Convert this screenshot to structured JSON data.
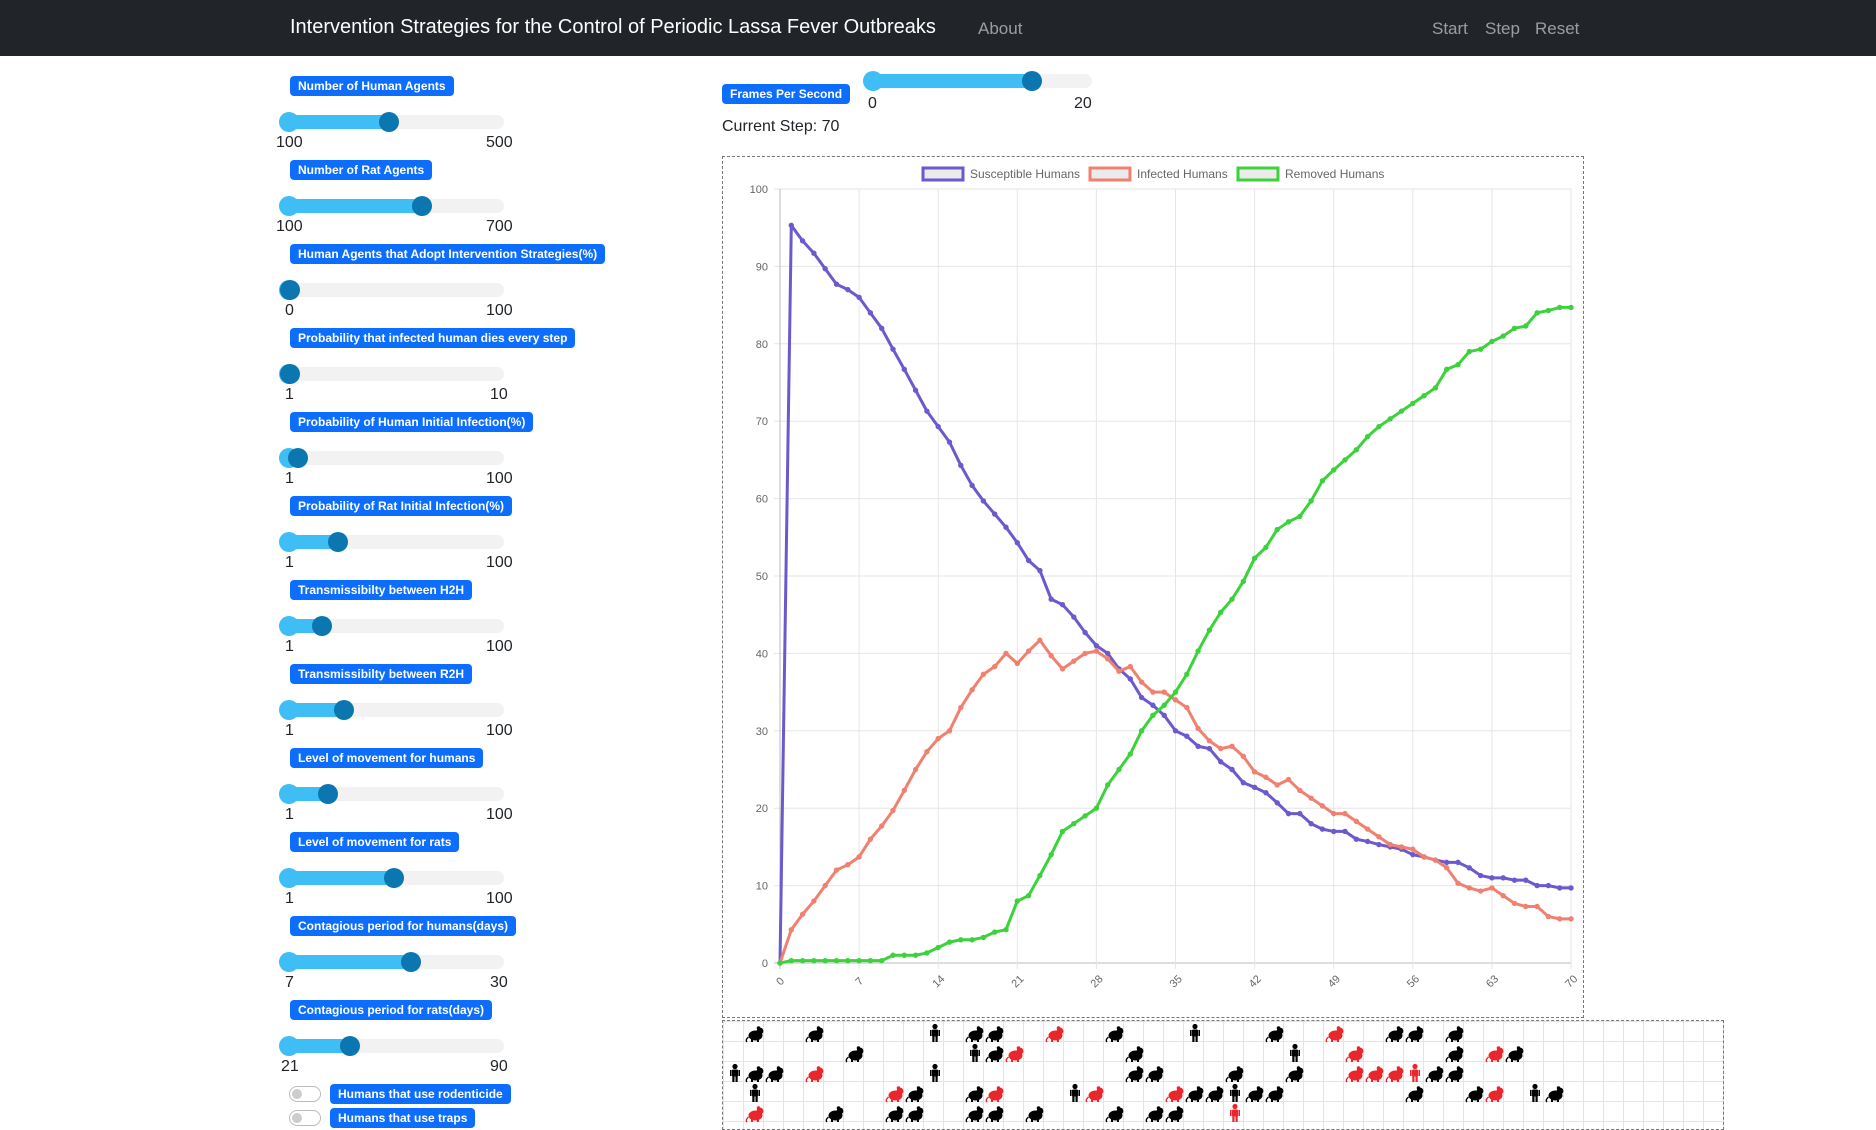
{
  "navbar": {
    "title": "Intervention Strategies for the Control of Periodic Lassa Fever Outbreaks",
    "about": "About",
    "start": "Start",
    "step": "Step",
    "reset": "Reset"
  },
  "fps": {
    "label": "Frames Per Second",
    "min": "0",
    "max": "20",
    "value": 16
  },
  "current_step": "Current Step: 70",
  "controls": [
    {
      "label": "Number of Human Agents",
      "min": "100",
      "max": "500",
      "value": 300
    },
    {
      "label": "Number of Rat Agents",
      "min": "100",
      "max": "700",
      "value": 500
    },
    {
      "label": "Human Agents that Adopt Intervention Strategies(%)",
      "min": "0",
      "max": "100",
      "value": 0
    },
    {
      "label": "Probability that infected human dies every step",
      "min": "1",
      "max": "10",
      "value": 1
    },
    {
      "label": "Probability of Human Initial Infection(%)",
      "min": "1",
      "max": "100",
      "value": 5
    },
    {
      "label": "Probability of Rat Initial Infection(%)",
      "min": "1",
      "max": "100",
      "value": 25
    },
    {
      "label": "Transmissibilty between H2H",
      "min": "1",
      "max": "100",
      "value": 17
    },
    {
      "label": "Transmissibilty between R2H",
      "min": "1",
      "max": "100",
      "value": 28
    },
    {
      "label": "Level of movement for humans",
      "min": "1",
      "max": "100",
      "value": 20
    },
    {
      "label": "Level of movement for rats",
      "min": "1",
      "max": "100",
      "value": 53
    },
    {
      "label": "Contagious period for humans(days)",
      "min": "7",
      "max": "30",
      "value": 21
    },
    {
      "label": "Contagious period for rats(days)",
      "min": "21",
      "max": "90",
      "value": 42
    }
  ],
  "toggles": [
    {
      "label": "Humans that use rodenticide",
      "on": false
    },
    {
      "label": "Humans that use traps",
      "on": false
    }
  ],
  "chart_data": {
    "type": "line",
    "legend_position": "top",
    "grid": true,
    "ylim": [
      0,
      100
    ],
    "xlim": [
      0,
      70
    ],
    "y_ticks": [
      "0",
      "10",
      "20",
      "30",
      "40",
      "50",
      "60",
      "70",
      "80",
      "90",
      "100"
    ],
    "x_ticks": [
      "0",
      "7",
      "14",
      "21",
      "28",
      "35",
      "42",
      "49",
      "56",
      "63",
      "70"
    ],
    "series": [
      {
        "name": "Susceptible Humans",
        "color": "#6a5acd",
        "values": [
          0,
          95.3,
          93.3,
          91.7,
          89.7,
          87.7,
          87,
          86,
          84,
          82,
          79.3,
          76.7,
          74,
          71.3,
          69.3,
          67.3,
          64.3,
          61.7,
          59.7,
          58,
          56.3,
          54.3,
          52,
          50.7,
          47,
          46.3,
          44.7,
          42.7,
          41,
          40,
          38,
          36.7,
          34.3,
          33.3,
          32,
          30,
          29.3,
          28,
          27.7,
          26,
          25,
          23.3,
          22.7,
          22,
          20.7,
          19.3,
          19.3,
          18,
          17.3,
          17,
          17,
          16,
          15.7,
          15.3,
          15,
          14.7,
          14,
          13.7,
          13.3,
          13,
          13,
          12.3,
          11.3,
          11,
          11,
          10.7,
          10.7,
          10,
          10,
          9.7,
          9.7
        ]
      },
      {
        "name": "Infected Humans",
        "color": "#f08070",
        "values": [
          0,
          4.3,
          6.3,
          8,
          10,
          12,
          12.7,
          13.7,
          16,
          17.7,
          19.7,
          22.3,
          25,
          27.3,
          29,
          30,
          33,
          35.3,
          37.3,
          38.3,
          40,
          38.7,
          40.3,
          41.7,
          39.7,
          38,
          39,
          40,
          40.3,
          39.3,
          37.7,
          38.3,
          36.3,
          35,
          35,
          34,
          33,
          30.3,
          28.7,
          27.7,
          28,
          26.7,
          24.7,
          24,
          23,
          23.7,
          22.3,
          21.3,
          20.3,
          19.3,
          19.3,
          18.3,
          17.3,
          16.3,
          15.3,
          15,
          14.7,
          13.7,
          13.3,
          12.3,
          10.3,
          9.7,
          9.3,
          9.7,
          8.7,
          7.7,
          7.3,
          7.3,
          6,
          5.7,
          5.7
        ]
      },
      {
        "name": "Removed Humans",
        "color": "#3cd23c",
        "values": [
          0,
          0.3,
          0.3,
          0.3,
          0.3,
          0.3,
          0.3,
          0.3,
          0.3,
          0.3,
          1,
          1,
          1,
          1.3,
          2,
          2.7,
          3,
          3,
          3.3,
          4,
          4.3,
          8,
          8.7,
          11.3,
          14,
          17,
          18,
          19,
          20,
          23,
          25,
          27,
          30,
          32,
          33.3,
          35,
          37.3,
          40.3,
          43,
          45.3,
          47,
          49.3,
          52.3,
          53.7,
          56,
          57,
          57.7,
          59.7,
          62.3,
          63.7,
          65,
          66.3,
          68,
          69.3,
          70.3,
          71.3,
          72.3,
          73.3,
          74.3,
          76.7,
          77.3,
          79,
          79.3,
          80.3,
          81,
          82,
          82.3,
          84,
          84.3,
          84.7,
          84.7
        ]
      }
    ]
  },
  "agents": [
    [
      "rat",
      "black",
      1,
      0
    ],
    [
      "rat",
      "black",
      4,
      0
    ],
    [
      "human",
      "black",
      10,
      0
    ],
    [
      "rat",
      "black",
      12,
      0
    ],
    [
      "rat",
      "black",
      13,
      0
    ],
    [
      "rat",
      "red",
      16,
      0
    ],
    [
      "rat",
      "black",
      19,
      0
    ],
    [
      "human",
      "black",
      23,
      0
    ],
    [
      "rat",
      "black",
      27,
      0
    ],
    [
      "rat",
      "red",
      30,
      0
    ],
    [
      "rat",
      "black",
      33,
      0
    ],
    [
      "rat",
      "black",
      34,
      0
    ],
    [
      "rat",
      "black",
      36,
      0
    ],
    [
      "rat",
      "black",
      6,
      1
    ],
    [
      "human",
      "black",
      12,
      1
    ],
    [
      "rat",
      "black",
      13,
      1
    ],
    [
      "rat",
      "red",
      14,
      1
    ],
    [
      "rat",
      "black",
      20,
      1
    ],
    [
      "human",
      "black",
      28,
      1
    ],
    [
      "rat",
      "red",
      31,
      1
    ],
    [
      "rat",
      "black",
      36,
      1
    ],
    [
      "rat",
      "red",
      38,
      1
    ],
    [
      "rat",
      "black",
      39,
      1
    ],
    [
      "human",
      "black",
      0,
      2
    ],
    [
      "rat",
      "black",
      1,
      2
    ],
    [
      "rat",
      "black",
      2,
      2
    ],
    [
      "rat",
      "red",
      4,
      2
    ],
    [
      "human",
      "black",
      10,
      2
    ],
    [
      "rat",
      "black",
      20,
      2
    ],
    [
      "rat",
      "black",
      21,
      2
    ],
    [
      "rat",
      "black",
      25,
      2
    ],
    [
      "rat",
      "black",
      28,
      2
    ],
    [
      "rat",
      "red",
      31,
      2
    ],
    [
      "rat",
      "red",
      32,
      2
    ],
    [
      "rat",
      "red",
      33,
      2
    ],
    [
      "human",
      "red",
      34,
      2
    ],
    [
      "rat",
      "black",
      35,
      2
    ],
    [
      "rat",
      "black",
      36,
      2
    ],
    [
      "human",
      "black",
      1,
      3
    ],
    [
      "rat",
      "red",
      8,
      3
    ],
    [
      "rat",
      "black",
      9,
      3
    ],
    [
      "rat",
      "black",
      12,
      3
    ],
    [
      "rat",
      "red",
      13,
      3
    ],
    [
      "human",
      "black",
      17,
      3
    ],
    [
      "rat",
      "red",
      18,
      3
    ],
    [
      "rat",
      "red",
      22,
      3
    ],
    [
      "rat",
      "black",
      23,
      3
    ],
    [
      "rat",
      "black",
      24,
      3
    ],
    [
      "human",
      "black",
      25,
      3
    ],
    [
      "rat",
      "black",
      26,
      3
    ],
    [
      "rat",
      "black",
      27,
      3
    ],
    [
      "rat",
      "black",
      34,
      3
    ],
    [
      "rat",
      "black",
      37,
      3
    ],
    [
      "rat",
      "red",
      38,
      3
    ],
    [
      "human",
      "black",
      40,
      3
    ],
    [
      "rat",
      "black",
      41,
      3
    ],
    [
      "rat",
      "red",
      1,
      4
    ],
    [
      "rat",
      "black",
      5,
      4
    ],
    [
      "rat",
      "black",
      8,
      4
    ],
    [
      "rat",
      "black",
      9,
      4
    ],
    [
      "rat",
      "black",
      12,
      4
    ],
    [
      "rat",
      "black",
      13,
      4
    ],
    [
      "rat",
      "black",
      15,
      4
    ],
    [
      "rat",
      "black",
      19,
      4
    ],
    [
      "rat",
      "black",
      21,
      4
    ],
    [
      "rat",
      "black",
      22,
      4
    ],
    [
      "human",
      "red",
      25,
      4
    ]
  ]
}
